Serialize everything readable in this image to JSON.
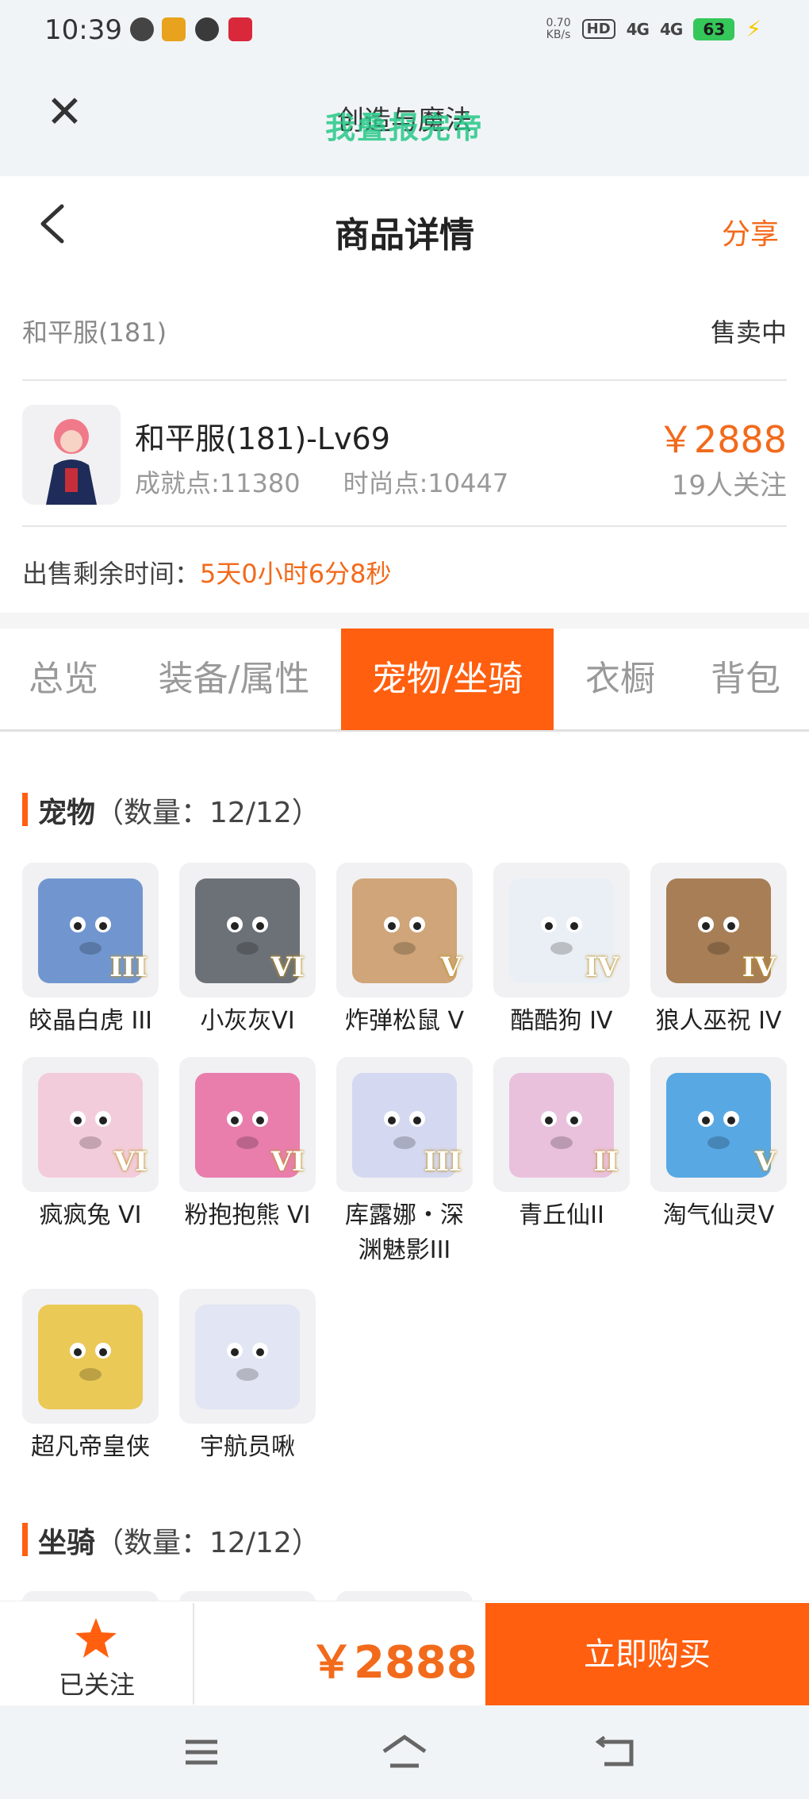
{
  "status_bar": {
    "time": "10:39",
    "speed_value": "0.70",
    "speed_unit": "KB/s",
    "hd": "HD",
    "sig1": "4G",
    "sig2": "4G",
    "battery": "63"
  },
  "web_header": {
    "title": "创造与魔法",
    "overlay_text": "我叠报完帝"
  },
  "page_header": {
    "title": "商品详情",
    "share": "分享"
  },
  "server": {
    "name": "和平服(181)",
    "status": "售卖中"
  },
  "item": {
    "name": "和平服(181)-Lv69",
    "achievement": "成就点:11380",
    "fashion": "时尚点:10447",
    "price": "￥2888",
    "followers": "19人关注"
  },
  "remaining": {
    "label": "出售剩余时间：",
    "value": "5天0小时6分8秒"
  },
  "tabs": [
    "总览",
    "装备/属性",
    "宠物/坐骑",
    "衣橱",
    "背包"
  ],
  "pets": {
    "title": "宠物",
    "count": "（数量：12/12）",
    "items": [
      {
        "label": "皎晶白虎 III",
        "rank": "III",
        "color": "#5a86c8"
      },
      {
        "label": "小灰灰VI",
        "rank": "VI",
        "color": "#555a60"
      },
      {
        "label": "炸弹松鼠 V",
        "rank": "V",
        "color": "#c99863"
      },
      {
        "label": "酷酷狗 IV",
        "rank": "IV",
        "color": "#e9eef5"
      },
      {
        "label": "狼人巫祝 IV",
        "rank": "IV",
        "color": "#9a6a3a"
      },
      {
        "label": "疯疯兔 VI",
        "rank": "VI",
        "color": "#f3c6d6"
      },
      {
        "label": "粉抱抱熊 VI",
        "rank": "VI",
        "color": "#e86aa0"
      },
      {
        "label": "库露娜・深渊魅影III",
        "rank": "III",
        "color": "#cfd3ee"
      },
      {
        "label": "青丘仙II",
        "rank": "II",
        "color": "#e7b8d8"
      },
      {
        "label": "淘气仙灵V",
        "rank": "V",
        "color": "#3d9be0"
      },
      {
        "label": "超凡帝皇侠",
        "rank": "",
        "color": "#e9c23a"
      },
      {
        "label": "宇航员啾",
        "rank": "",
        "color": "#dfe3f2"
      }
    ]
  },
  "mounts": {
    "title": "坐骑",
    "count": "（数量：12/12）"
  },
  "bottom": {
    "follow_label": "已关注",
    "price": "￥2888",
    "buy": "立即购买"
  },
  "colors": {
    "accent": "#ff5f0f",
    "price": "#f26a1b"
  }
}
